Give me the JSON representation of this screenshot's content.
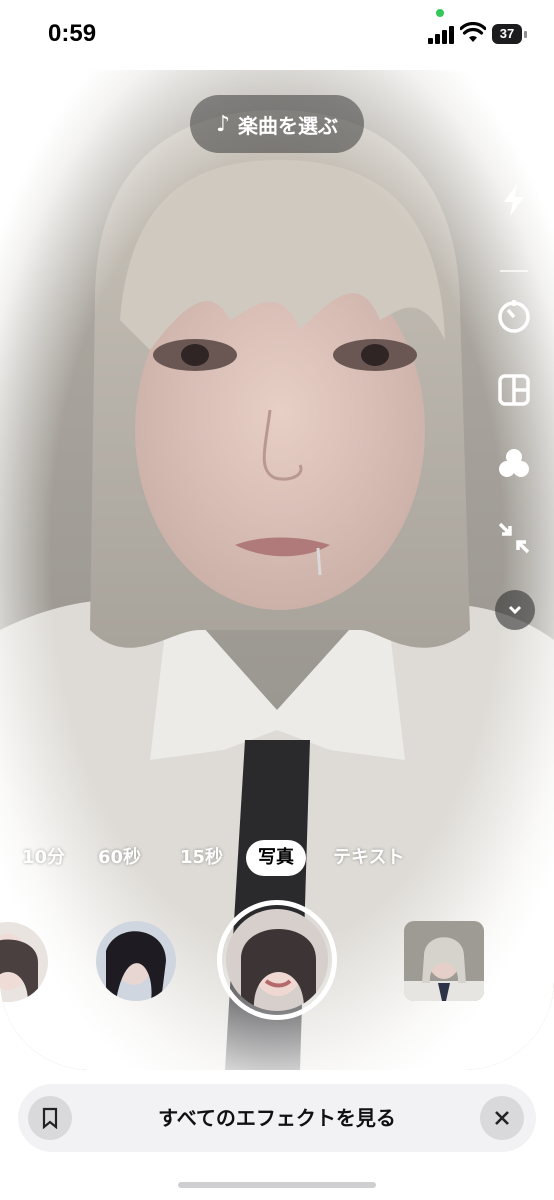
{
  "status": {
    "time": "0:59",
    "battery": "37"
  },
  "camera": {
    "music_label": "楽曲を選ぶ",
    "close_glyph": "×",
    "tools": [
      "flip-camera-icon",
      "flash-icon",
      "timer-icon",
      "layout-icon",
      "filters-icon",
      "shrink-icon",
      "chevron-down-icon"
    ],
    "modes": [
      {
        "label": "10分",
        "active": false
      },
      {
        "label": "60秒",
        "active": false
      },
      {
        "label": "15秒",
        "active": false
      },
      {
        "label": "写真",
        "active": true
      },
      {
        "label": "テキスト",
        "active": false
      }
    ]
  },
  "bottom": {
    "effects_label": "すべてのエフェクトを見る"
  },
  "colors": {
    "accent": "#ffffff",
    "bar_bg": "#f2f2f4",
    "pill_bg": "#3c3c3c"
  }
}
